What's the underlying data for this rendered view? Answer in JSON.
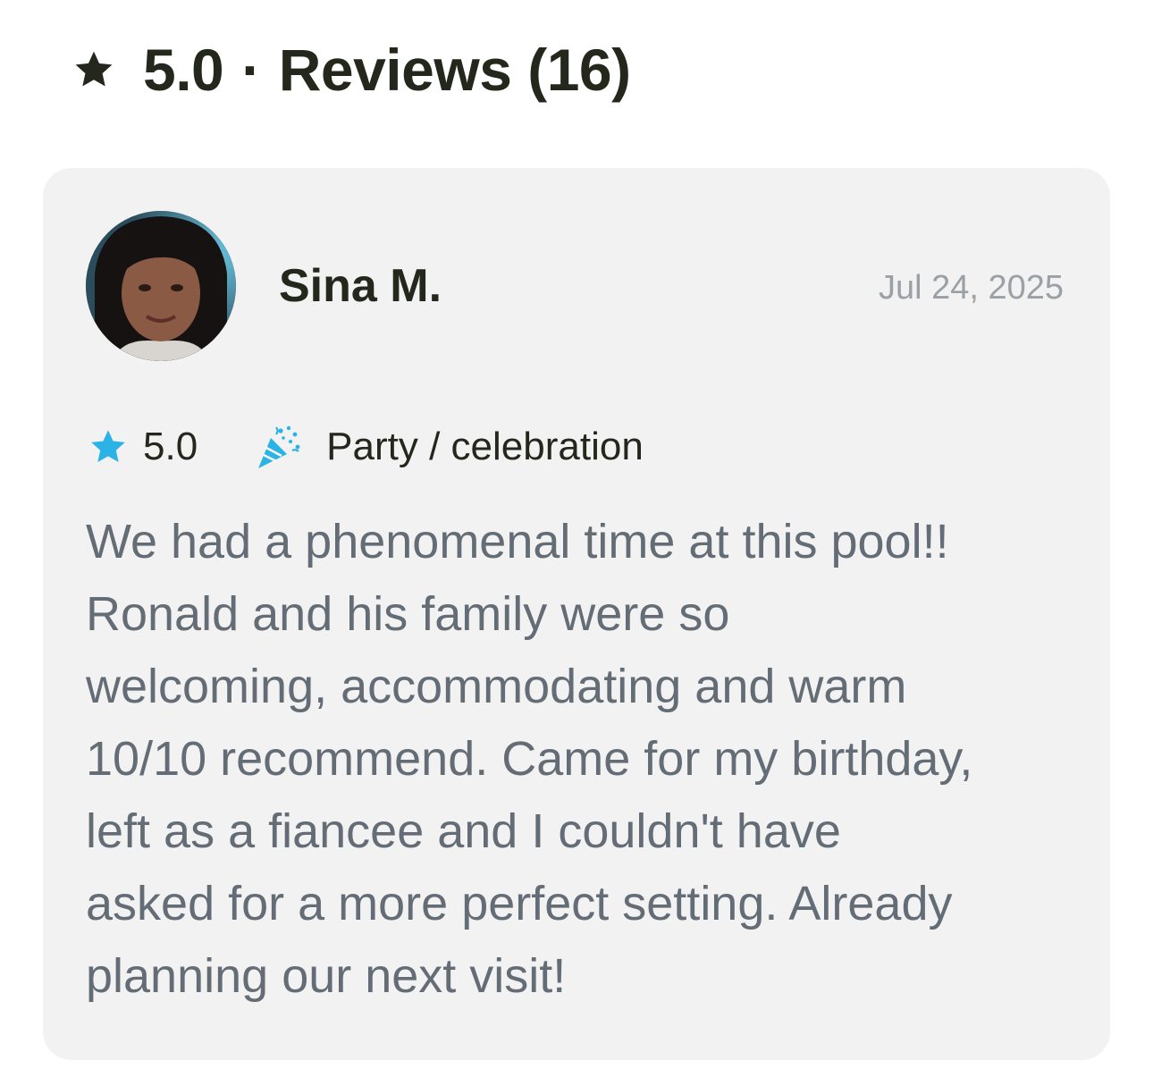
{
  "header": {
    "rating": "5.0",
    "separator": "·",
    "reviews_label": "Reviews (16)",
    "star_icon": "star-icon"
  },
  "review": {
    "reviewer_name": "Sina M.",
    "date": "Jul 24, 2025",
    "rating": "5.0",
    "occasion": "Party / celebration",
    "occasion_icon": "party-popper-icon",
    "text": "We had a phenomenal time at this pool!!\nRonald and his family were so\nwelcoming, accommodating and warm\n10/10 recommend. Came for my birthday,\nleft as a fiancee and I couldn't have\nasked for a more perfect setting. Already\nplanning our next visit!"
  },
  "colors": {
    "accent_blue": "#2bb3e6",
    "heading_text": "#24271c",
    "body_text": "#646d76",
    "card_bg": "#f2f2f2",
    "date_text": "#9aa0a6"
  }
}
